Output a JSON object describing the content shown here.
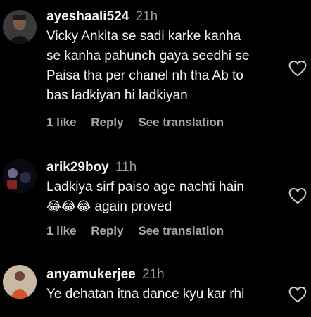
{
  "comments": [
    {
      "username": "ayeshaali524",
      "time": "21h",
      "lines": [
        "Vicky Ankita se sadi karke kanha",
        "se kanha pahunch gaya seedhi se",
        "Paisa tha per chanel nh tha Ab to",
        "bas ladkiyan hi ladkiyan"
      ],
      "likes": "1 like",
      "reply": "Reply",
      "translate": "See translation"
    },
    {
      "username": "arik29boy",
      "time": "11h",
      "lines": [
        "Ladkiya sirf paiso age nachti hain",
        "again proved"
      ],
      "emojis": "😂😂😂",
      "likes": "1 like",
      "reply": "Reply",
      "translate": "See translation"
    },
    {
      "username": "anyamukerjee",
      "time": "21h",
      "lines": [
        "Ye dehatan itna dance kyu kar rhi"
      ]
    }
  ]
}
